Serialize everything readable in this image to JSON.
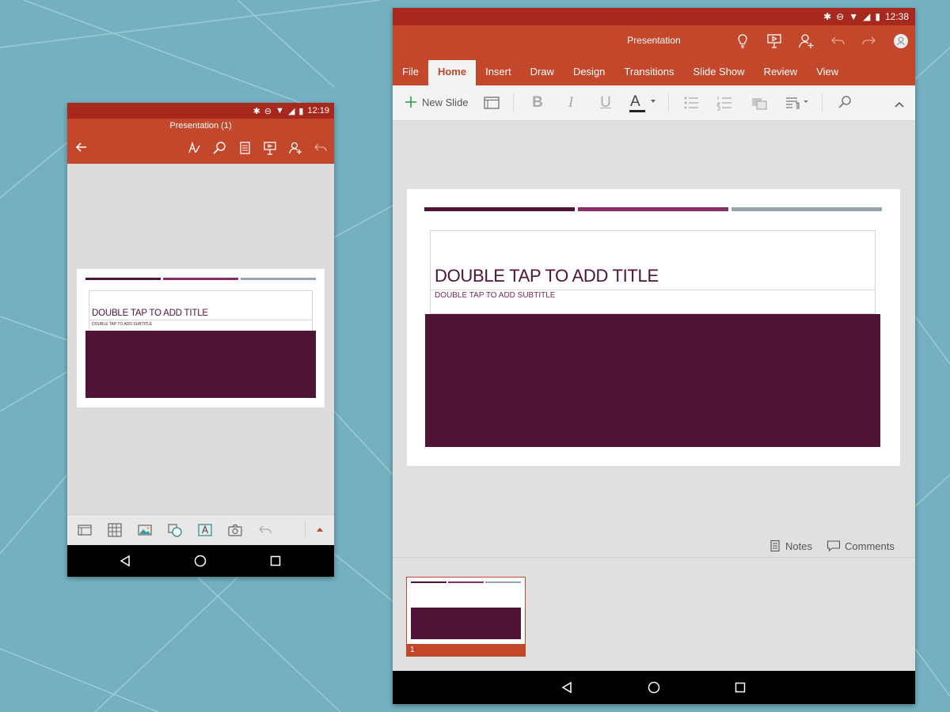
{
  "colors": {
    "background": "#74b0bf",
    "status_bar": "#a7281d",
    "accent": "#c2472b",
    "slide_dark": "#4f1336",
    "slide_mid": "#8a2e6a",
    "slide_gray": "#9aa4ab"
  },
  "phone": {
    "status": {
      "time": "12:19",
      "icons": [
        "bluetooth-icon",
        "dnd-icon",
        "wifi-icon",
        "signal-icon",
        "battery-icon"
      ]
    },
    "header": {
      "title": "Presentation (1)",
      "icons": [
        "back-arrow-icon",
        "pen-icon",
        "search-icon",
        "notes-icon",
        "present-icon",
        "share-icon",
        "undo-icon"
      ]
    },
    "slide": {
      "title_placeholder": "DOUBLE TAP TO ADD TITLE",
      "subtitle_placeholder": "DOUBLE TAP TO ADD SUBTITLE"
    },
    "bottom_toolbar": {
      "icons": [
        "layout-icon",
        "table-icon",
        "picture-icon",
        "shapes-icon",
        "textbox-icon",
        "camera-icon",
        "undo-icon",
        "expand-caret-icon"
      ]
    },
    "nav": [
      "back-triangle-icon",
      "home-circle-icon",
      "recents-square-icon"
    ]
  },
  "tablet": {
    "status": {
      "time": "12:38",
      "icons": [
        "bluetooth-icon",
        "dnd-icon",
        "wifi-icon",
        "signal-icon",
        "battery-icon"
      ]
    },
    "header": {
      "title": "Presentation",
      "icons": [
        "lightbulb-icon",
        "present-icon",
        "share-icon",
        "undo-icon",
        "redo-icon",
        "account-icon"
      ]
    },
    "tabs": [
      "File",
      "Home",
      "Insert",
      "Draw",
      "Design",
      "Transitions",
      "Slide Show",
      "Review",
      "View"
    ],
    "active_tab": "Home",
    "ribbon": {
      "new_slide_label": "New Slide",
      "icons": [
        "layout-icon",
        "bold-icon",
        "italic-icon",
        "underline-icon",
        "font-color-icon",
        "bullets-icon",
        "numbering-icon",
        "shape-fill-icon",
        "paragraph-icon",
        "search-icon",
        "collapse-ribbon-icon"
      ],
      "bold": "B",
      "italic": "I",
      "underline": "U",
      "font_color": "A"
    },
    "slide": {
      "title_placeholder": "DOUBLE TAP TO ADD TITLE",
      "subtitle_placeholder": "DOUBLE TAP TO ADD SUBTITLE"
    },
    "notes_label": "Notes",
    "comments_label": "Comments",
    "thumbnails": [
      {
        "number": "1"
      }
    ],
    "nav": [
      "back-triangle-icon",
      "home-circle-icon",
      "recents-square-icon"
    ]
  }
}
